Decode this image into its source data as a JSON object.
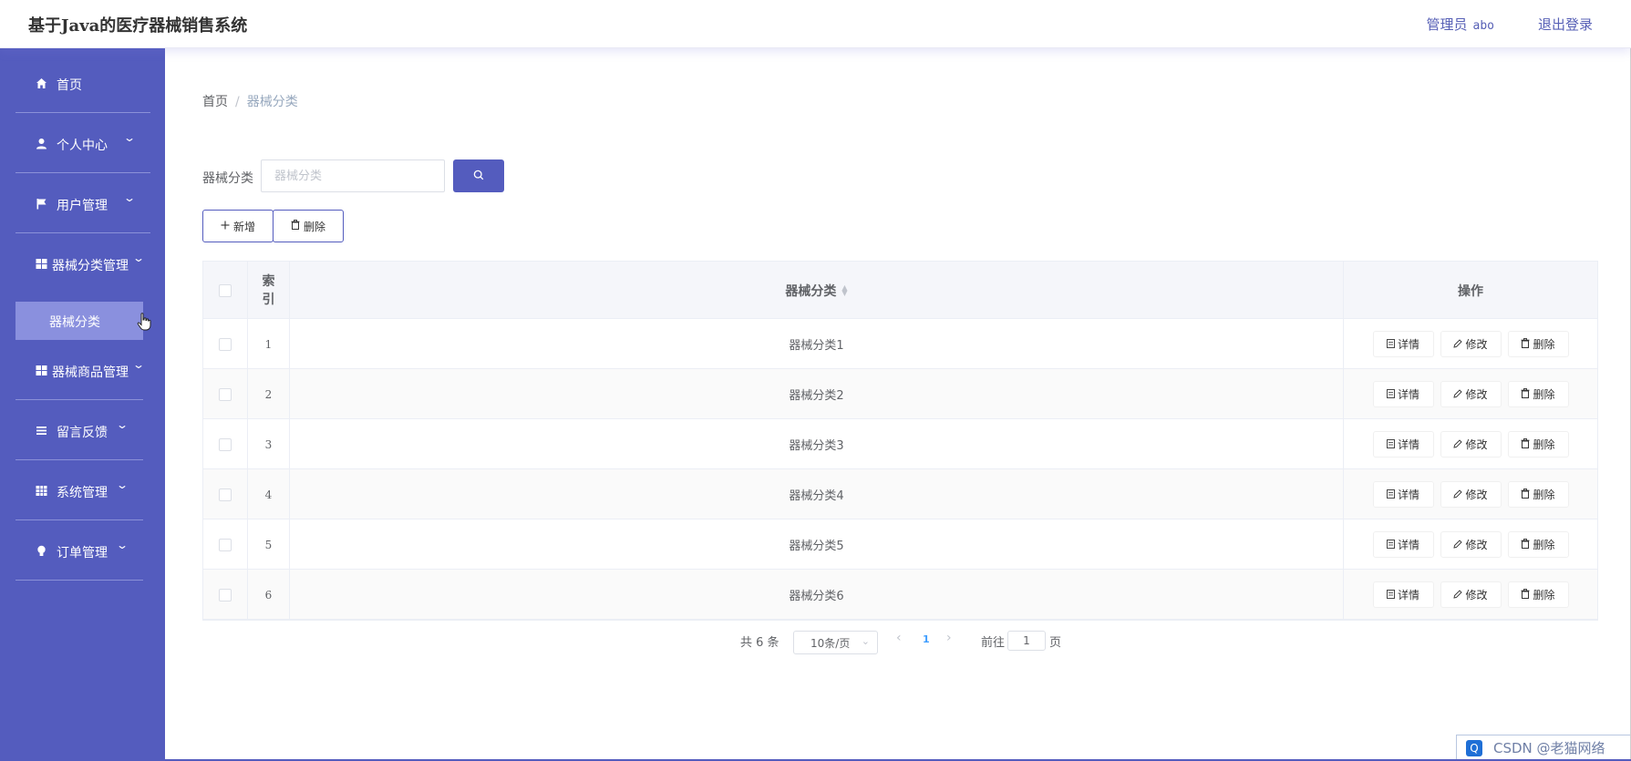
{
  "header": {
    "app_title": "基于Java的医疗器械销售系统",
    "admin_role": "管理员",
    "admin_name": "abo",
    "logout_label": "退出登录"
  },
  "sidebar": {
    "items": [
      {
        "label": "首页",
        "icon": "home-icon"
      },
      {
        "label": "个人中心",
        "icon": "user-icon"
      },
      {
        "label": "用户管理",
        "icon": "flag-icon"
      },
      {
        "label": "器械分类管理",
        "icon": "grid-icon"
      },
      {
        "label": "器械商品管理",
        "icon": "grid-icon"
      },
      {
        "label": "留言反馈",
        "icon": "menu-lines-icon"
      },
      {
        "label": "系统管理",
        "icon": "table-icon"
      },
      {
        "label": "订单管理",
        "icon": "bulb-icon"
      }
    ],
    "active_subitem": "器械分类"
  },
  "breadcrumb": {
    "home": "首页",
    "current": "器械分类"
  },
  "search": {
    "label": "器械分类",
    "placeholder": "器械分类"
  },
  "actions": {
    "add_label": "新增",
    "delete_label": "删除"
  },
  "table": {
    "columns": {
      "index_top": "索",
      "index_bottom": "引",
      "name": "器械分类",
      "ops": "操作"
    },
    "rows": [
      {
        "index": "1",
        "name": "器械分类1"
      },
      {
        "index": "2",
        "name": "器械分类2"
      },
      {
        "index": "3",
        "name": "器械分类3"
      },
      {
        "index": "4",
        "name": "器械分类4"
      },
      {
        "index": "5",
        "name": "器械分类5"
      },
      {
        "index": "6",
        "name": "器械分类6"
      }
    ],
    "row_actions": {
      "detail": "详情",
      "edit": "修改",
      "delete": "删除"
    }
  },
  "pagination": {
    "total_text": "共 6 条",
    "page_size": "10条/页",
    "current_page": "1",
    "goto_label": "前往",
    "goto_value": "1",
    "goto_unit": "页"
  },
  "watermark": {
    "text": "CSDN @老猫网络"
  },
  "colors": {
    "sidebar_bg": "#545cbe",
    "submenu_active_bg": "#8a90de",
    "accent": "#545cbe"
  }
}
